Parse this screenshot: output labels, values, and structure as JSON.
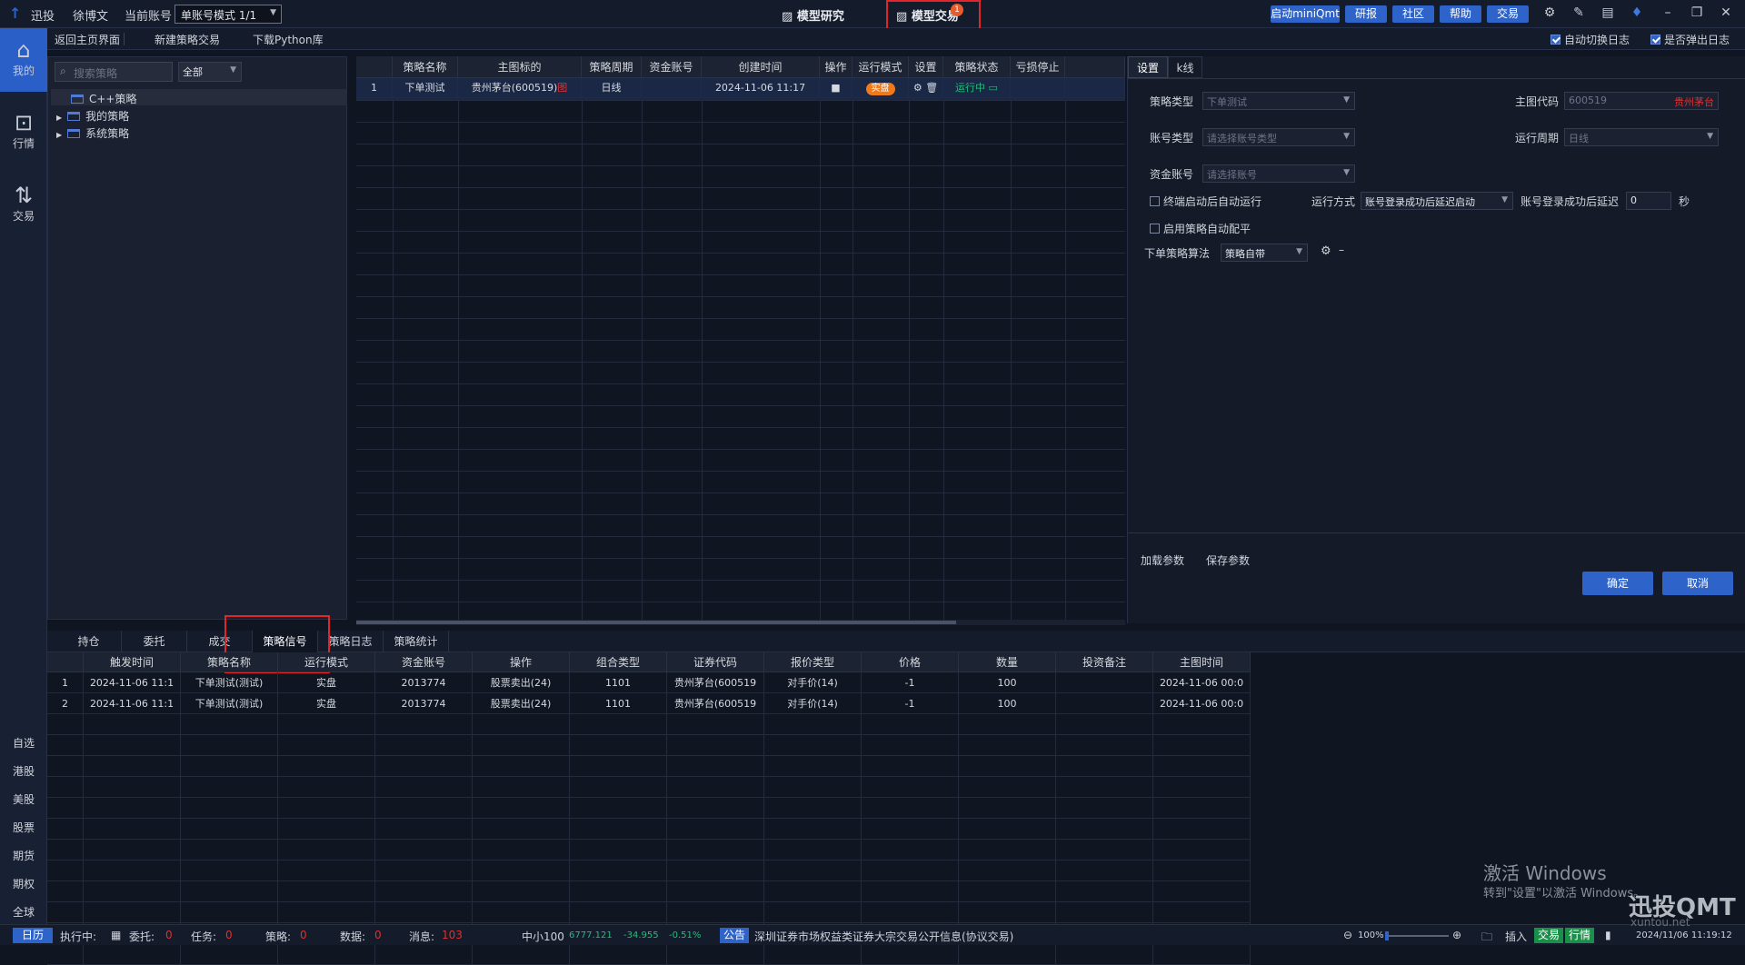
{
  "topbar": {
    "brand": "迅投",
    "user": "徐博文",
    "account_label": "当前账号",
    "account_mode": "单账号模式 1/1",
    "tab_research": "模型研究",
    "tab_trade": "模型交易",
    "trade_badge": "1",
    "buttons": [
      "启动miniQmt",
      "研报",
      "社区",
      "帮助",
      "交易"
    ],
    "colors": {
      "accent": "#2e63c9",
      "highlight": "#e0262b"
    }
  },
  "subbar": {
    "home": "返回主页界面",
    "new_strategy": "新建策略交易",
    "download": "下载Python库",
    "auto_log": "自动切换日志",
    "popup_log": "是否弹出日志"
  },
  "leftnav": {
    "items": [
      {
        "label": "我的",
        "icon": "home-icon"
      },
      {
        "label": "行情",
        "icon": "chart-icon"
      },
      {
        "label": "交易",
        "icon": "trade-icon"
      }
    ],
    "bottom": [
      "自选",
      "港股",
      "美股",
      "股票",
      "期货",
      "期权",
      "全球"
    ]
  },
  "tree": {
    "search_placeholder": "搜索策略",
    "filter": "全部",
    "items": [
      "C++策略",
      "我的策略",
      "系统策略"
    ]
  },
  "grid": {
    "headers": [
      "",
      "策略名称",
      "主图标的",
      "策略周期",
      "资金账号",
      "创建时间",
      "操作",
      "运行模式",
      "设置",
      "策略状态",
      "亏损停止"
    ],
    "row": {
      "idx": "1",
      "name": "下单测试",
      "symbol": "贵州茅台(600519)",
      "symbol_tag": "图",
      "period": "日线",
      "account": "",
      "created": "2024-11-06 11:17",
      "mode": "实盘",
      "state": "运行中"
    }
  },
  "rpanel": {
    "tabs": [
      "设置",
      "k线"
    ],
    "strategy_type_label": "策略类型",
    "strategy_type": "下单测试",
    "main_code_label": "主图代码",
    "main_code": "600519",
    "main_name": "贵州茅台",
    "account_type_label": "账号类型",
    "account_type_ph": "请选择账号类型",
    "run_period_label": "运行周期",
    "run_period": "日线",
    "fund_account_label": "资金账号",
    "fund_account_ph": "请选择账号",
    "auto_run": "终端启动后自动运行",
    "run_mode_label": "运行方式",
    "run_mode": "账号登录成功后延迟启动",
    "delay_label": "账号登录成功后延迟",
    "delay_value": "0",
    "delay_unit": "秒",
    "auto_level": "启用策略自动配平",
    "algo_label": "下单策略算法",
    "algo": "策略自带",
    "load": "加载参数",
    "save": "保存参数",
    "ok": "确定",
    "cancel": "取消"
  },
  "btabs": [
    "持仓",
    "委托",
    "成交",
    "策略信号",
    "策略日志",
    "策略统计"
  ],
  "signals": {
    "headers": [
      "",
      "触发时间",
      "策略名称",
      "运行模式",
      "资金账号",
      "操作",
      "组合类型",
      "证券代码",
      "报价类型",
      "价格",
      "数量",
      "投资备注",
      "主图时间"
    ],
    "rows": [
      [
        "1",
        "2024-11-06 11:1",
        "下单测试(测试)",
        "实盘",
        "2013774",
        "股票卖出(24)",
        "1101",
        "贵州茅台(600519",
        "对手价(14)",
        "-1",
        "100",
        "",
        "2024-11-06 00:0"
      ],
      [
        "2",
        "2024-11-06 11:1",
        "下单测试(测试)",
        "实盘",
        "2013774",
        "股票卖出(24)",
        "1101",
        "贵州茅台(600519",
        "对手价(14)",
        "-1",
        "100",
        "",
        "2024-11-06 00:0"
      ]
    ]
  },
  "status": {
    "calendar": "日历",
    "running": "执行中:",
    "order": "委托:",
    "order_n": "0",
    "task": "任务:",
    "task_n": "0",
    "strategy": "策略:",
    "strategy_n": "0",
    "data": "数据:",
    "data_n": "0",
    "msg": "消息:",
    "msg_n": "103",
    "index": "中小100",
    "index_val": "6777.121",
    "index_chg": "-34.955",
    "index_pct": "-0.51%",
    "notice_tag": "公告",
    "notice": "深圳证券市场权益类证券大宗交易公开信息(协议交易)",
    "zoom": "100%",
    "insert": "插入",
    "trade": "交易",
    "quote": "行情",
    "time": "2024/11/06 11:19:12"
  },
  "watermark": {
    "line1": "激活 Windows",
    "line2": "转到\"设置\"以激活 Windows。",
    "brand": "迅投QMT",
    "site": "xuntou.net"
  }
}
